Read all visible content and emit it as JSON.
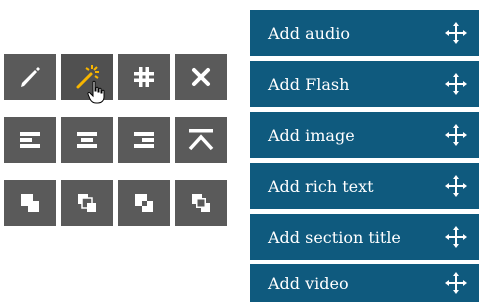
{
  "colors": {
    "button_bg": "#5a5a5a",
    "button_active_bg": "#505050",
    "icon": "#ffffff",
    "magic_wand_accent": "#f7b500",
    "panel_bg": "#0f5a7e",
    "panel_divider": "#ffffff"
  },
  "toolbar": {
    "rows": [
      [
        {
          "name": "edit-button",
          "icon": "pencil-icon"
        },
        {
          "name": "magic-wand-button",
          "icon": "magic-wand-icon",
          "state": "hovered"
        },
        {
          "name": "grid-button",
          "icon": "hash-grid-icon"
        },
        {
          "name": "delete-button",
          "icon": "close-icon"
        }
      ],
      [
        {
          "name": "align-left-button",
          "icon": "align-left-icon"
        },
        {
          "name": "align-center-button",
          "icon": "align-center-icon"
        },
        {
          "name": "align-right-button",
          "icon": "align-right-icon"
        },
        {
          "name": "align-top-button",
          "icon": "align-top-icon"
        }
      ],
      [
        {
          "name": "bring-to-front-button",
          "icon": "layer-front-icon"
        },
        {
          "name": "bring-forward-button",
          "icon": "layer-forward-icon"
        },
        {
          "name": "send-backward-button",
          "icon": "layer-backward-icon"
        },
        {
          "name": "send-to-back-button",
          "icon": "layer-back-icon"
        }
      ]
    ]
  },
  "add_menu": {
    "items": [
      {
        "label": "Add audio",
        "icon": "move-icon"
      },
      {
        "label": "Add Flash",
        "icon": "move-icon"
      },
      {
        "label": "Add image",
        "icon": "move-icon"
      },
      {
        "label": "Add rich text",
        "icon": "move-icon"
      },
      {
        "label": "Add section title",
        "icon": "move-icon"
      },
      {
        "label": "Add video",
        "icon": "move-icon"
      }
    ]
  }
}
